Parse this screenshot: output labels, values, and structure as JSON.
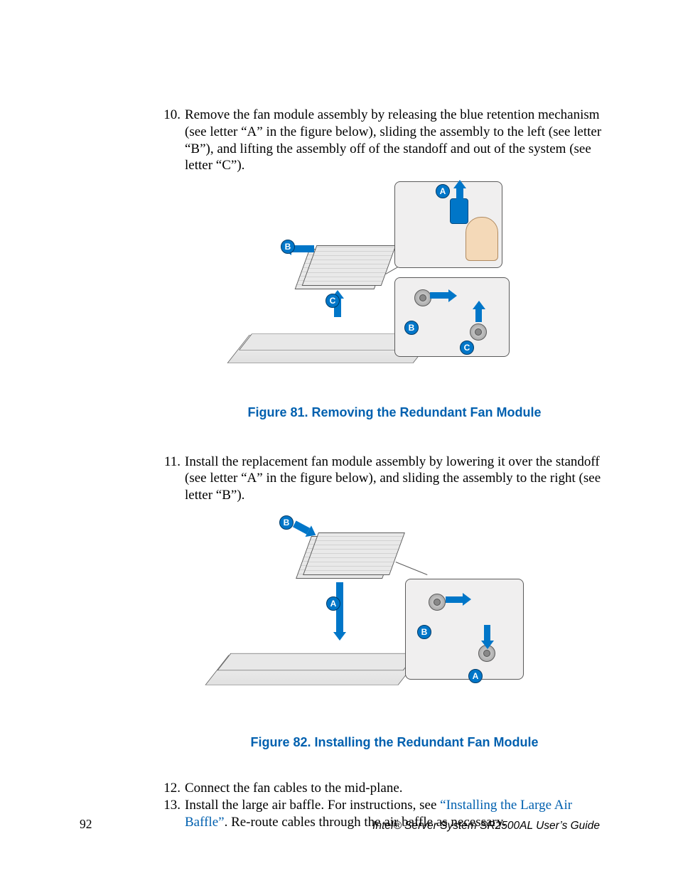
{
  "colors": {
    "link_blue": "#0060af",
    "accent_blue": "#0076c8"
  },
  "steps": {
    "s10": {
      "number": "10.",
      "text": "Remove the fan module assembly by releasing the blue retention mechanism (see letter “A” in the figure below), sliding the assembly to the left (see letter “B”), and lifting the assembly off of the standoff and out of the system (see letter “C”)."
    },
    "s11": {
      "number": "11.",
      "text": "Install the replacement fan module assembly by lowering it over the standoff (see letter “A” in the figure below), and sliding the assembly to the right (see letter “B”)."
    },
    "s12": {
      "number": "12.",
      "text": "Connect the fan cables to the mid-plane."
    },
    "s13": {
      "number": "13.",
      "text_a": "Install the large air baffle. For instructions, see ",
      "link": "“Installing the Large Air Baffle”",
      "text_b": ". Re-route cables through the air baffle as necessary."
    }
  },
  "figures": {
    "f81": {
      "caption": "Figure 81. Removing the Redundant Fan Module",
      "labels": {
        "A": "A",
        "B": "B",
        "C": "C"
      }
    },
    "f82": {
      "caption": "Figure 82. Installing the Redundant Fan Module",
      "labels": {
        "A": "A",
        "B": "B"
      }
    }
  },
  "footer": {
    "page_number": "92",
    "doc_title": "Intel® Server System SR2500AL User’s Guide"
  }
}
